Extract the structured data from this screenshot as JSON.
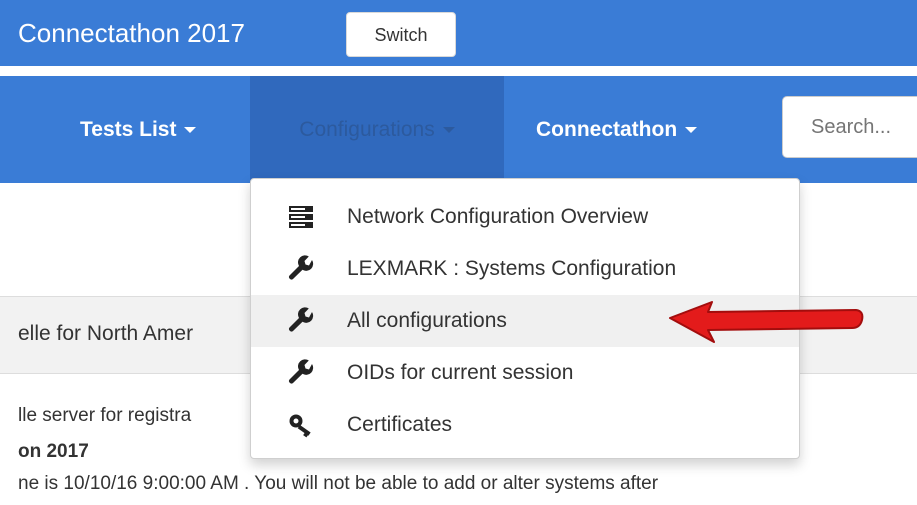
{
  "header": {
    "brand": "Connectathon 2017",
    "switch_label": "Switch"
  },
  "nav": {
    "tests_list": "Tests List",
    "configurations": "Configurations",
    "connectathon": "Connectathon",
    "search_placeholder": "Search..."
  },
  "dropdown": {
    "items": [
      {
        "label": "Network Configuration Overview",
        "icon": "server-icon"
      },
      {
        "label": "LEXMARK : Systems Configuration",
        "icon": "wrench-icon"
      },
      {
        "label": "All configurations",
        "icon": "wrench-icon"
      },
      {
        "label": "OIDs for current session",
        "icon": "wrench-icon"
      },
      {
        "label": "Certificates",
        "icon": "key-icon"
      }
    ]
  },
  "content": {
    "panel_title": "elle for North Amer",
    "info_line1": "lle server for registra",
    "info_line2": "on 2017",
    "info_line3": "ne is 10/10/16 9:00:00 AM . You will not be able to add or alter systems after"
  },
  "colors": {
    "nav_blue": "#3a7cd6",
    "active_nav": "#3069bd",
    "arrow_red": "#e31b1b"
  }
}
